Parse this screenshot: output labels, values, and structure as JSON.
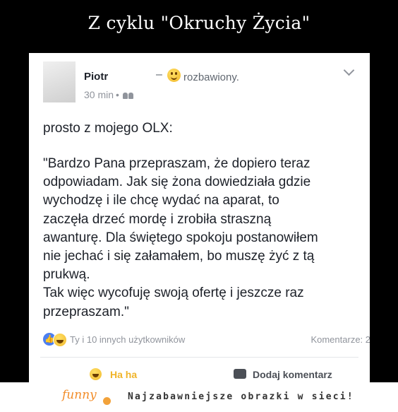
{
  "meme_title": "Z cyklu \"Okruchy Życia\"",
  "post": {
    "author": "Piotr",
    "dash": "–",
    "feeling": "rozbawiony.",
    "time": "30 min",
    "dot": "•",
    "intro": "prosto z mojego OLX:",
    "quote": "\"Bardzo Pana przepraszam, że dopiero teraz\nodpowiadam. Jak się żona dowiedziała gdzie\nwychodzę i ile chcę wydać na aparat, to\nzaczęła drzeć mordę i zrobiła straszną\nawanturę. Dla świętego spokoju postanowiłem\nnie jechać i się załamałem, bo muszę żyć z tą\nprukwą.\nTak więc wycofuję swoją ofertę i jeszcze raz\nprzepraszam.\"",
    "reactions_text": "Ty i 10 innych użytkowników",
    "comments_count": "Komentarze: 2",
    "haha_label": "Ha ha",
    "comment_label": "Dodaj komentarz"
  },
  "footer": {
    "logo": "funny",
    "tagline": "Najzabawniejsze obrazki w sieci!"
  },
  "colors": {
    "haha": "#f0b429",
    "like": "#4c7ff0",
    "meta": "#90949c"
  }
}
